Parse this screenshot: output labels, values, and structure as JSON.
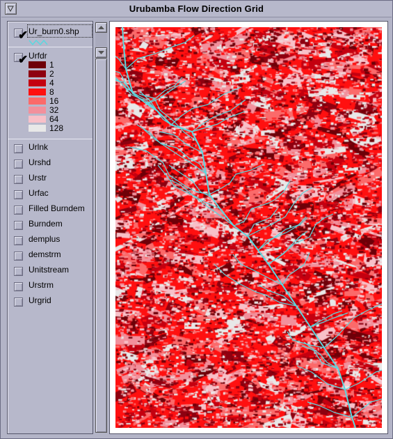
{
  "window": {
    "title": "Urubamba Flow Direction Grid"
  },
  "toc": {
    "layers": [
      {
        "name": "Ur_burn0.shp",
        "checked": true
      },
      {
        "name": "Urfdr",
        "checked": true
      },
      {
        "name": "Urlnk",
        "checked": false
      },
      {
        "name": "Urshd",
        "checked": false
      },
      {
        "name": "Urstr",
        "checked": false
      },
      {
        "name": "Urfac",
        "checked": false
      },
      {
        "name": "Filled Burndem",
        "checked": false
      },
      {
        "name": "Burndem",
        "checked": false
      },
      {
        "name": "demplus",
        "checked": false
      },
      {
        "name": "demstrm",
        "checked": false
      },
      {
        "name": "Unitstream",
        "checked": false
      },
      {
        "name": "Urstrm",
        "checked": false
      },
      {
        "name": "Urgrid",
        "checked": false
      }
    ],
    "check_glyph": "✔",
    "legend": [
      {
        "label": "1",
        "color": "#6e0008"
      },
      {
        "label": "2",
        "color": "#8e0010"
      },
      {
        "label": "4",
        "color": "#c40010"
      },
      {
        "label": "8",
        "color": "#ff1010"
      },
      {
        "label": "16",
        "color": "#fb6a6a"
      },
      {
        "label": "32",
        "color": "#f2909c"
      },
      {
        "label": "64",
        "color": "#f8c0c8"
      },
      {
        "label": "128",
        "color": "#e8e8e8"
      }
    ],
    "stream_symbol_color": "#5ad8e0"
  },
  "map": {
    "stream_color": "#5ad8e0"
  }
}
